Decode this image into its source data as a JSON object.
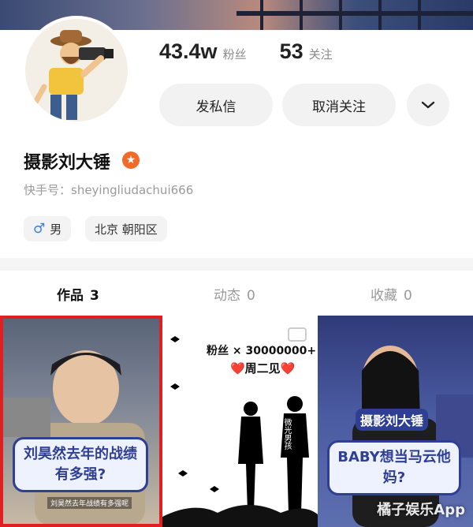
{
  "profile": {
    "fans_count": "43.4w",
    "fans_label": "粉丝",
    "following_count": "53",
    "following_label": "关注",
    "name": "摄影刘大锤",
    "id_line": "快手号：sheyingliudachui666",
    "gender": "男",
    "location": "北京 朝阳区"
  },
  "actions": {
    "message_label": "发私信",
    "unfollow_label": "取消关注"
  },
  "tabs": [
    {
      "label": "作品",
      "count": "3"
    },
    {
      "label": "动态",
      "count": "0"
    },
    {
      "label": "收藏",
      "count": "0"
    }
  ],
  "posts": [
    {
      "caption": "刘昊然去年的战绩有多强?",
      "subtitle": "刘昊然去年战绩有多强呢"
    },
    {
      "headline": "粉丝 × 30000000+",
      "subline": "❤️周二见❤️",
      "sign": "微光男孩"
    },
    {
      "caption": "BABY想当马云他妈?",
      "overlay": "摄影刘大锤"
    }
  ],
  "watermark": "橘子娱乐App"
}
